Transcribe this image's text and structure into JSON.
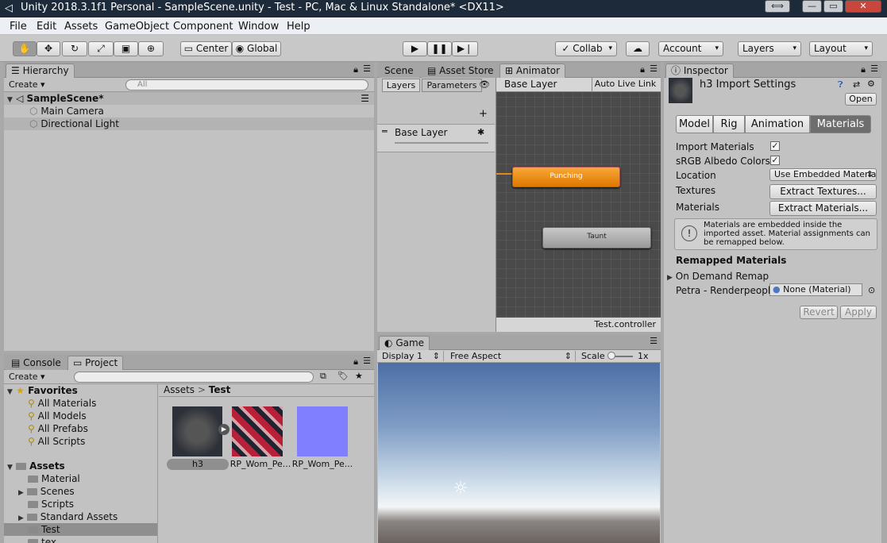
{
  "window": {
    "title": "Unity 2018.3.1f1 Personal - SampleScene.unity - Test - PC, Mac & Linux Standalone* <DX11>"
  },
  "menu": [
    "File",
    "Edit",
    "Assets",
    "GameObject",
    "Component",
    "Window",
    "Help"
  ],
  "toolbar": {
    "center": "Center",
    "global": "Global",
    "collab": "Collab",
    "account": "Account",
    "layers": "Layers",
    "layout": "Layout"
  },
  "hierarchy": {
    "tab": "Hierarchy",
    "create": "Create",
    "search_placeholder": "All",
    "scene": "SampleScene*",
    "items": [
      "Main Camera",
      "Directional Light"
    ]
  },
  "center_tabs": {
    "scene": "Scene",
    "asset_store": "Asset Store",
    "animator": "Animator"
  },
  "animator": {
    "layers_tab": "Layers",
    "parameters_tab": "Parameters",
    "breadcrumb": "Base Layer",
    "auto_live_link": "Auto Live Link",
    "layer_name": "Base Layer",
    "states": [
      "Punching",
      "Taunt"
    ],
    "footer": "Test.controller"
  },
  "game": {
    "tab": "Game",
    "display": "Display 1",
    "aspect": "Free Aspect",
    "scale_label": "Scale",
    "scale_value": "1x"
  },
  "bottom_tabs": {
    "console": "Console",
    "project": "Project"
  },
  "project": {
    "create": "Create",
    "favorites_label": "Favorites",
    "favorites": [
      "All Materials",
      "All Models",
      "All Prefabs",
      "All Scripts"
    ],
    "assets_label": "Assets",
    "folders": [
      "Material",
      "Scenes",
      "Scripts",
      "Standard Assets",
      "Test",
      "tex"
    ],
    "breadcrumb_root": "Assets",
    "breadcrumb_current": "Test",
    "assets": [
      "h3",
      "RP_Wom_Pe...",
      "RP_Wom_Pe..."
    ]
  },
  "inspector": {
    "tab": "Inspector",
    "title": "h3 Import Settings",
    "open": "Open",
    "tabs": [
      "Model",
      "Rig",
      "Animation",
      "Materials"
    ],
    "import_materials": "Import Materials",
    "srgb": "sRGB Albedo Colors",
    "location_label": "Location",
    "location_value": "Use Embedded Material",
    "textures_label": "Textures",
    "textures_btn": "Extract Textures...",
    "materials_label": "Materials",
    "materials_btn": "Extract Materials...",
    "info": "Materials are embedded inside the imported asset. Material assignments can be remapped below.",
    "remapped": "Remapped Materials",
    "on_demand": "On Demand Remap",
    "petra_label": "Petra - Renderpeople",
    "petra_value": "None (Material)",
    "revert": "Revert",
    "apply": "Apply"
  },
  "colors": {
    "accent_orange": "#f28b0c",
    "selected_tab": "#6e6e6e",
    "titlebar": "#1d2a3a"
  }
}
